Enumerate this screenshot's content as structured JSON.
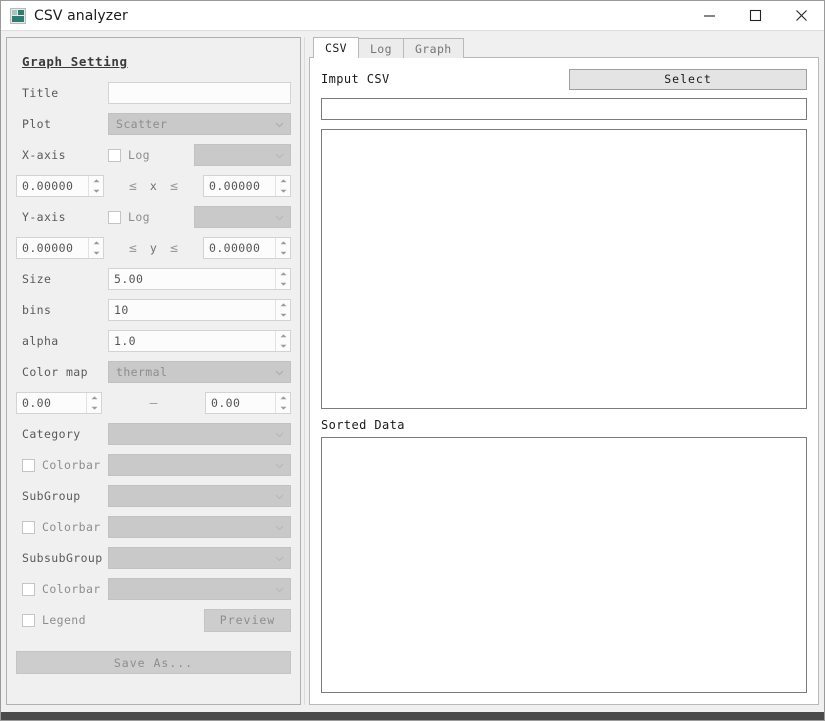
{
  "window": {
    "title": "CSV analyzer",
    "icon": "app-icon",
    "minimize_label": "—",
    "maximize_label": "□",
    "close_label": "✕"
  },
  "graph_setting": {
    "heading": "Graph Setting",
    "title": {
      "label": "Title",
      "value": "",
      "placeholder": ""
    },
    "plot": {
      "label": "Plot",
      "value": "Scatter"
    },
    "x_axis": {
      "label": "X-axis",
      "log_label": "Log",
      "log_checked": false,
      "column_value": "",
      "min_value": "0.00000",
      "max_value": "0.00000",
      "op_left": "≤",
      "var": "x",
      "op_right": "≤"
    },
    "y_axis": {
      "label": "Y-axis",
      "log_label": "Log",
      "log_checked": false,
      "column_value": "",
      "min_value": "0.00000",
      "max_value": "0.00000",
      "op_left": "≤",
      "var": "y",
      "op_right": "≤"
    },
    "size": {
      "label": "Size",
      "value": "5.00"
    },
    "bins": {
      "label": "bins",
      "value": "10"
    },
    "alpha": {
      "label": "alpha",
      "value": "1.0"
    },
    "color_map": {
      "label": "Color map",
      "value": "thermal"
    },
    "color_range": {
      "min_value": "0.00",
      "separator": "–",
      "max_value": "0.00"
    },
    "category": {
      "label": "Category",
      "value": ""
    },
    "category_colorbar": {
      "label": "Colorbar",
      "checked": false,
      "value": ""
    },
    "subgroup": {
      "label": "SubGroup",
      "value": ""
    },
    "subgroup_colorbar": {
      "label": "Colorbar",
      "checked": false,
      "value": ""
    },
    "subsubgroup": {
      "label": "SubsubGroup",
      "value": ""
    },
    "subsubgroup_colorbar": {
      "label": "Colorbar",
      "checked": false,
      "value": ""
    },
    "legend": {
      "label": "Legend",
      "checked": false
    },
    "preview_button": "Preview",
    "save_as_button": "Save As..."
  },
  "right_panel": {
    "tabs": [
      {
        "label": "CSV",
        "active": true
      },
      {
        "label": "Log",
        "active": false
      },
      {
        "label": "Graph",
        "active": false
      }
    ],
    "csv_tab": {
      "input_label": "Imput CSV",
      "select_button": "Select",
      "path_value": "",
      "path_placeholder": "",
      "table_rows": [],
      "sorted_label": "Sorted Data",
      "sorted_rows": []
    }
  },
  "colors": {
    "window_bg": "#f0f0f0",
    "panel_border": "#b0b0b0",
    "disabled_combo": "#c9c9c9",
    "disabled_text": "#8d8d8d",
    "label_text": "#5a5a5a",
    "field_bg": "#fcfcfc",
    "tab_active_bg": "#ffffff",
    "table_border": "#7a7a7a",
    "statusbar": "#4a4a4a",
    "icon_accent": "#2e7d72"
  }
}
